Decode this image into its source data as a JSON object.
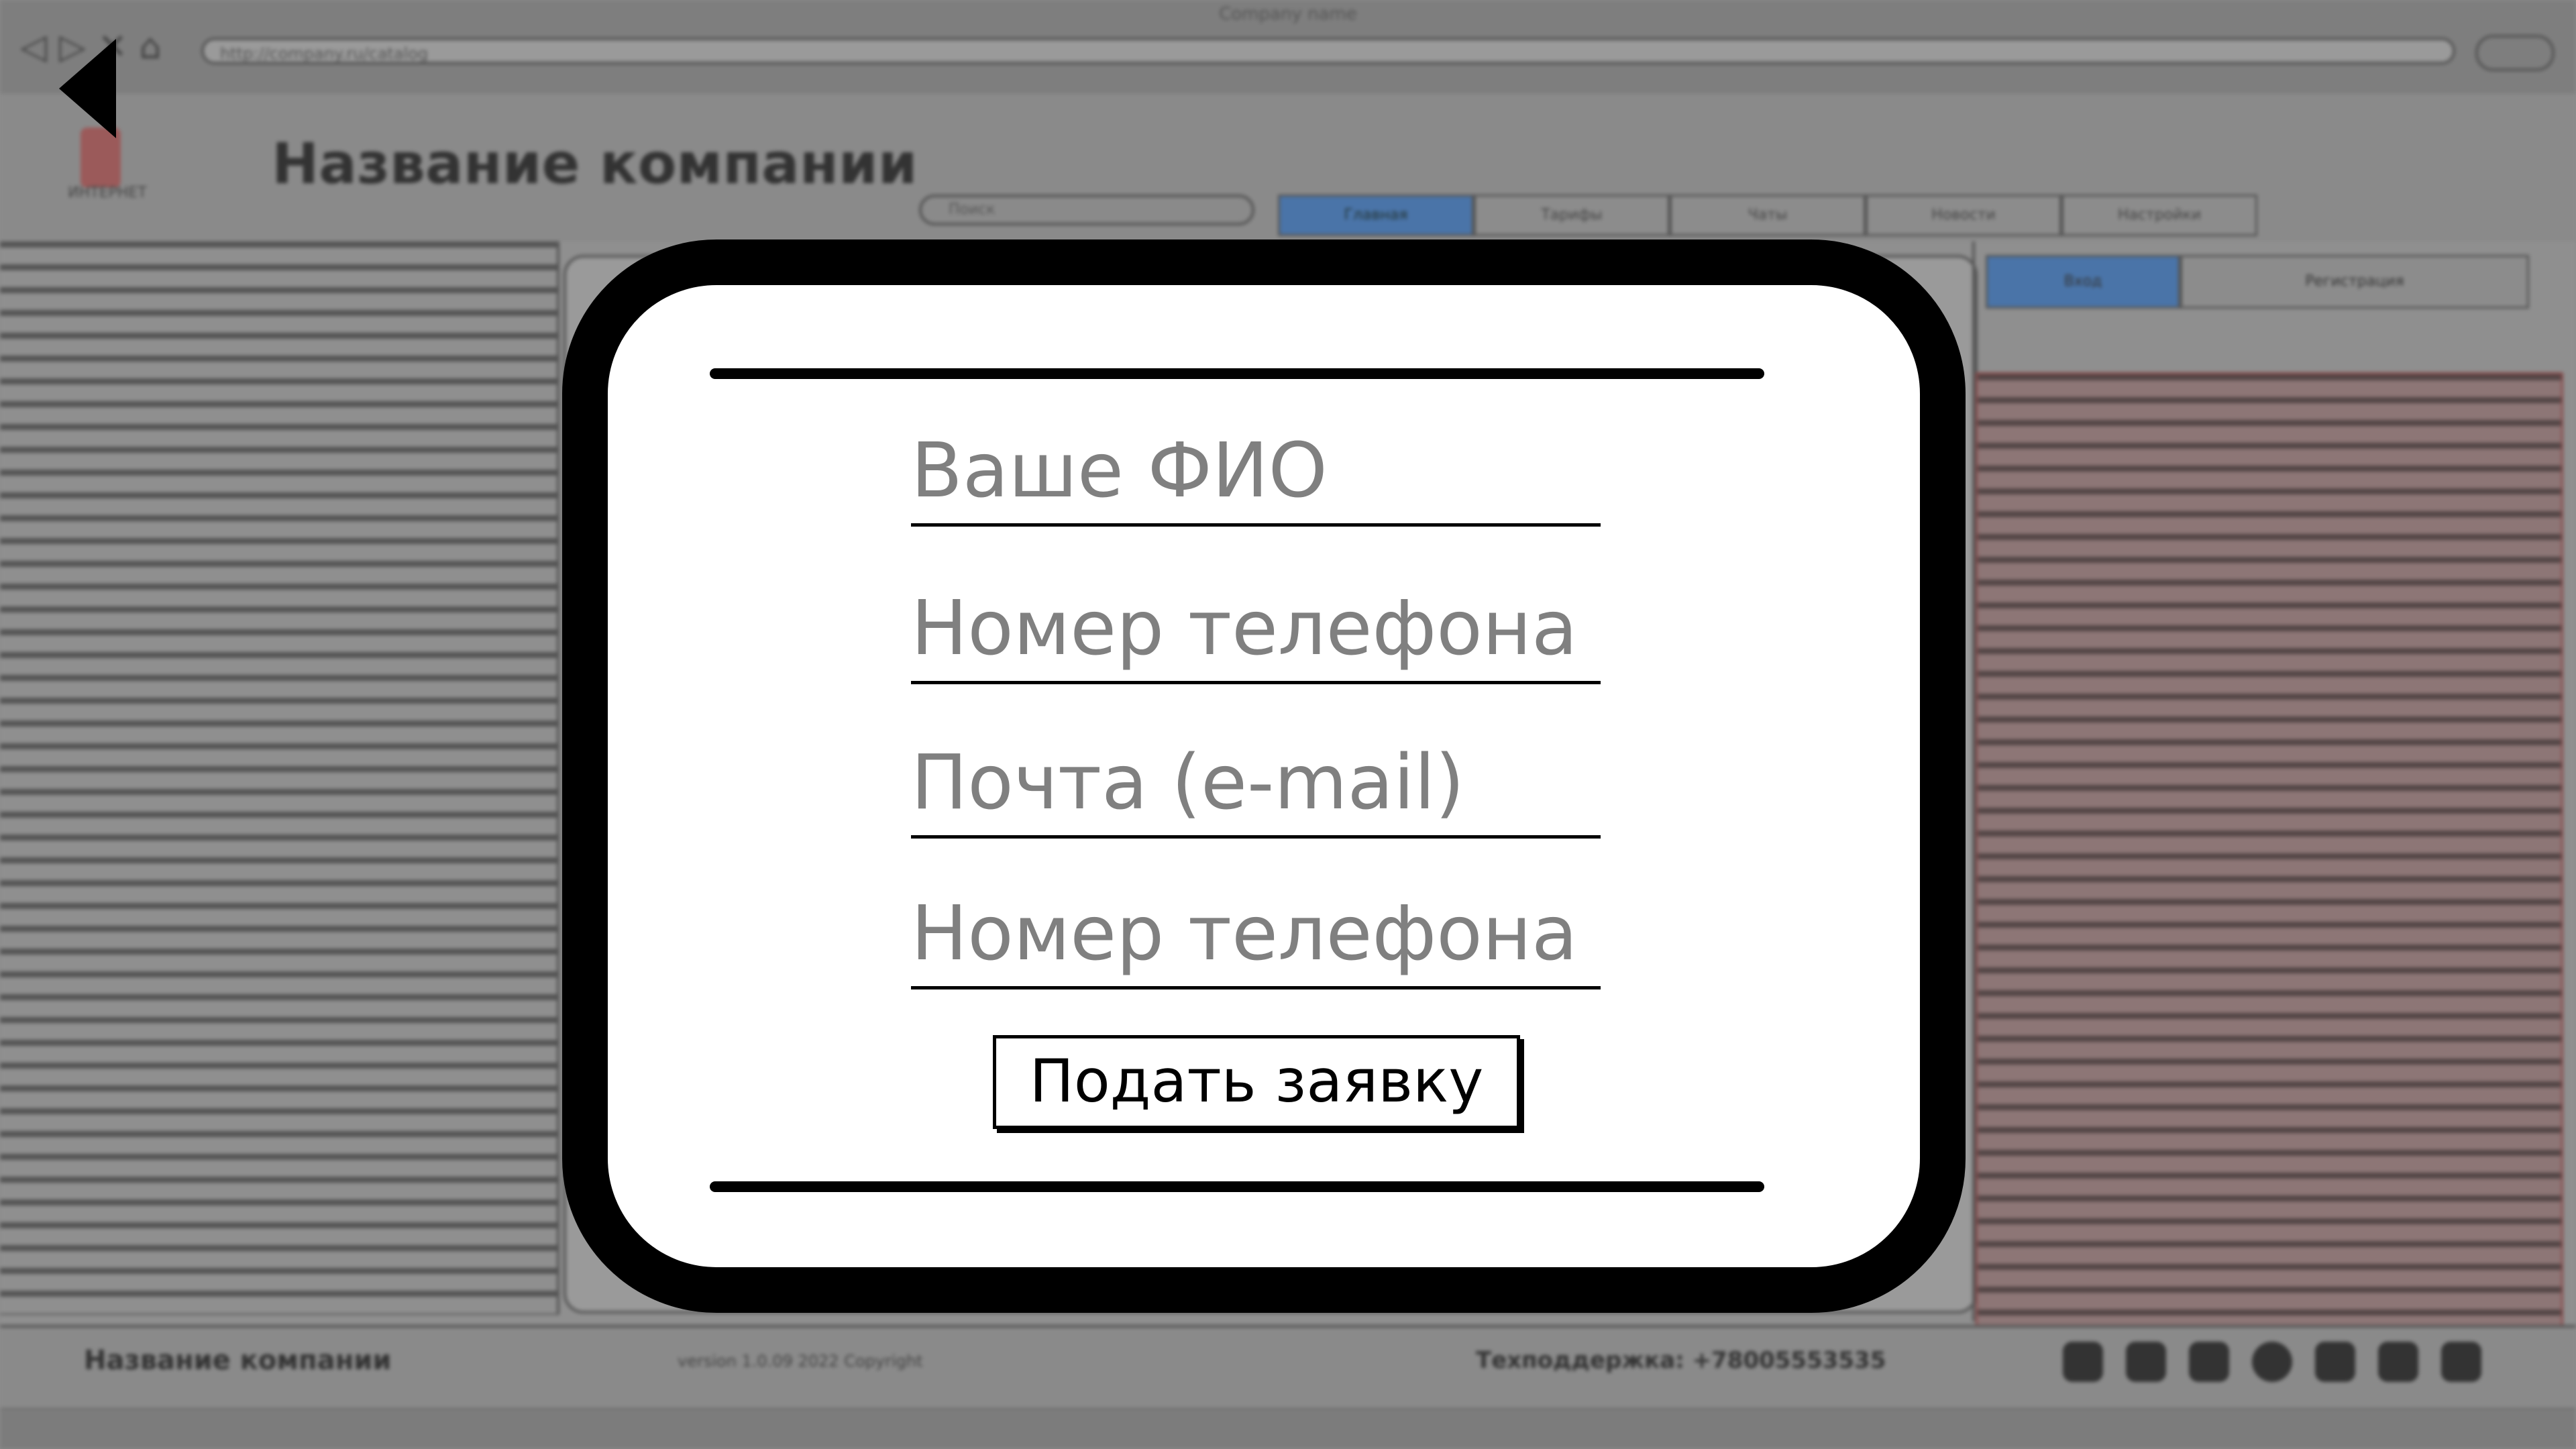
{
  "browser": {
    "title": "Company name",
    "url": "http://company.ru/catalog"
  },
  "header": {
    "logo_text": "ИНТЕРНЕТ",
    "company_title": "Название компании",
    "search_placeholder": "Поиск",
    "tabs": [
      "Главная",
      "Тарифы",
      "Чаты",
      "Новости",
      "Настройки"
    ]
  },
  "right_panel": {
    "tabs": [
      "Вход",
      "Регистрация"
    ]
  },
  "footer": {
    "company": "Название компании",
    "version": "version 1.0.09 2022 Copyright",
    "support": "Техподдержка: +78005553535"
  },
  "modal": {
    "fields": [
      {
        "placeholder": "Ваше ФИО"
      },
      {
        "placeholder": "Номер телефона"
      },
      {
        "placeholder": "Почта (e-mail)"
      },
      {
        "placeholder": "Номер телефона"
      }
    ],
    "submit_label": "Подать заявку"
  },
  "icons": {
    "back": "back-arrow-icon",
    "social": [
      "instagram-icon",
      "linkedin-icon",
      "vk-icon",
      "telegram-icon",
      "twitter-icon",
      "facebook-icon",
      "youtube-icon"
    ]
  }
}
